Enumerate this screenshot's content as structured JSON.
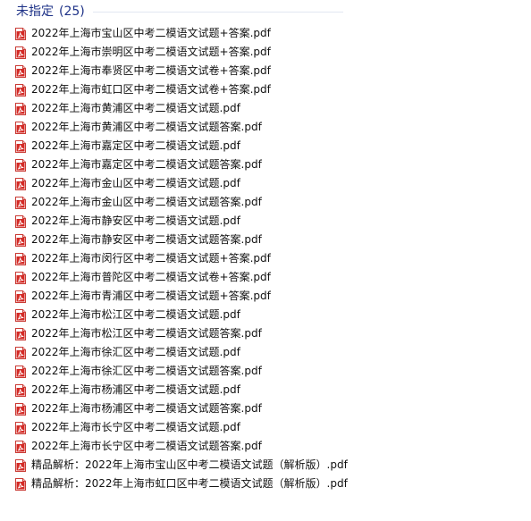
{
  "group": {
    "title": "未指定",
    "count": "(25)"
  },
  "files": [
    {
      "name": "2022年上海市宝山区中考二模语文试题+答案.pdf",
      "icon": "pdf-icon"
    },
    {
      "name": "2022年上海市崇明区中考二模语文试题+答案.pdf",
      "icon": "pdf-icon"
    },
    {
      "name": "2022年上海市奉贤区中考二模语文试卷+答案.pdf",
      "icon": "pdf-icon"
    },
    {
      "name": "2022年上海市虹口区中考二模语文试卷+答案.pdf",
      "icon": "pdf-icon"
    },
    {
      "name": "2022年上海市黄浦区中考二模语文试题.pdf",
      "icon": "pdf-icon"
    },
    {
      "name": "2022年上海市黄浦区中考二模语文试题答案.pdf",
      "icon": "pdf-icon"
    },
    {
      "name": "2022年上海市嘉定区中考二模语文试题.pdf",
      "icon": "pdf-icon"
    },
    {
      "name": "2022年上海市嘉定区中考二模语文试题答案.pdf",
      "icon": "pdf-icon"
    },
    {
      "name": "2022年上海市金山区中考二模语文试题.pdf",
      "icon": "pdf-icon"
    },
    {
      "name": "2022年上海市金山区中考二模语文试题答案.pdf",
      "icon": "pdf-icon"
    },
    {
      "name": "2022年上海市静安区中考二模语文试题.pdf",
      "icon": "pdf-icon"
    },
    {
      "name": "2022年上海市静安区中考二模语文试题答案.pdf",
      "icon": "pdf-icon"
    },
    {
      "name": "2022年上海市闵行区中考二模语文试题+答案.pdf",
      "icon": "pdf-icon"
    },
    {
      "name": "2022年上海市普陀区中考二模语文试卷+答案.pdf",
      "icon": "pdf-icon"
    },
    {
      "name": "2022年上海市青浦区中考二模语文试题+答案.pdf",
      "icon": "pdf-icon"
    },
    {
      "name": "2022年上海市松江区中考二模语文试题.pdf",
      "icon": "pdf-icon"
    },
    {
      "name": "2022年上海市松江区中考二模语文试题答案.pdf",
      "icon": "pdf-icon"
    },
    {
      "name": "2022年上海市徐汇区中考二模语文试题.pdf",
      "icon": "pdf-icon"
    },
    {
      "name": "2022年上海市徐汇区中考二模语文试题答案.pdf",
      "icon": "pdf-icon"
    },
    {
      "name": "2022年上海市杨浦区中考二模语文试题.pdf",
      "icon": "pdf-icon"
    },
    {
      "name": "2022年上海市杨浦区中考二模语文试题答案.pdf",
      "icon": "pdf-icon"
    },
    {
      "name": "2022年上海市长宁区中考二模语文试题.pdf",
      "icon": "pdf-icon"
    },
    {
      "name": "2022年上海市长宁区中考二模语文试题答案.pdf",
      "icon": "pdf-icon"
    },
    {
      "name": "精品解析：2022年上海市宝山区中考二模语文试题（解析版）.pdf",
      "icon": "pdf-icon"
    },
    {
      "name": "精品解析：2022年上海市虹口区中考二模语文试题（解析版）.pdf",
      "icon": "pdf-icon"
    }
  ],
  "colors": {
    "group_title": "#1e3287",
    "group_rule": "#e2e7f2",
    "file_text": "#111111",
    "pdf_icon": "#d42a25"
  }
}
